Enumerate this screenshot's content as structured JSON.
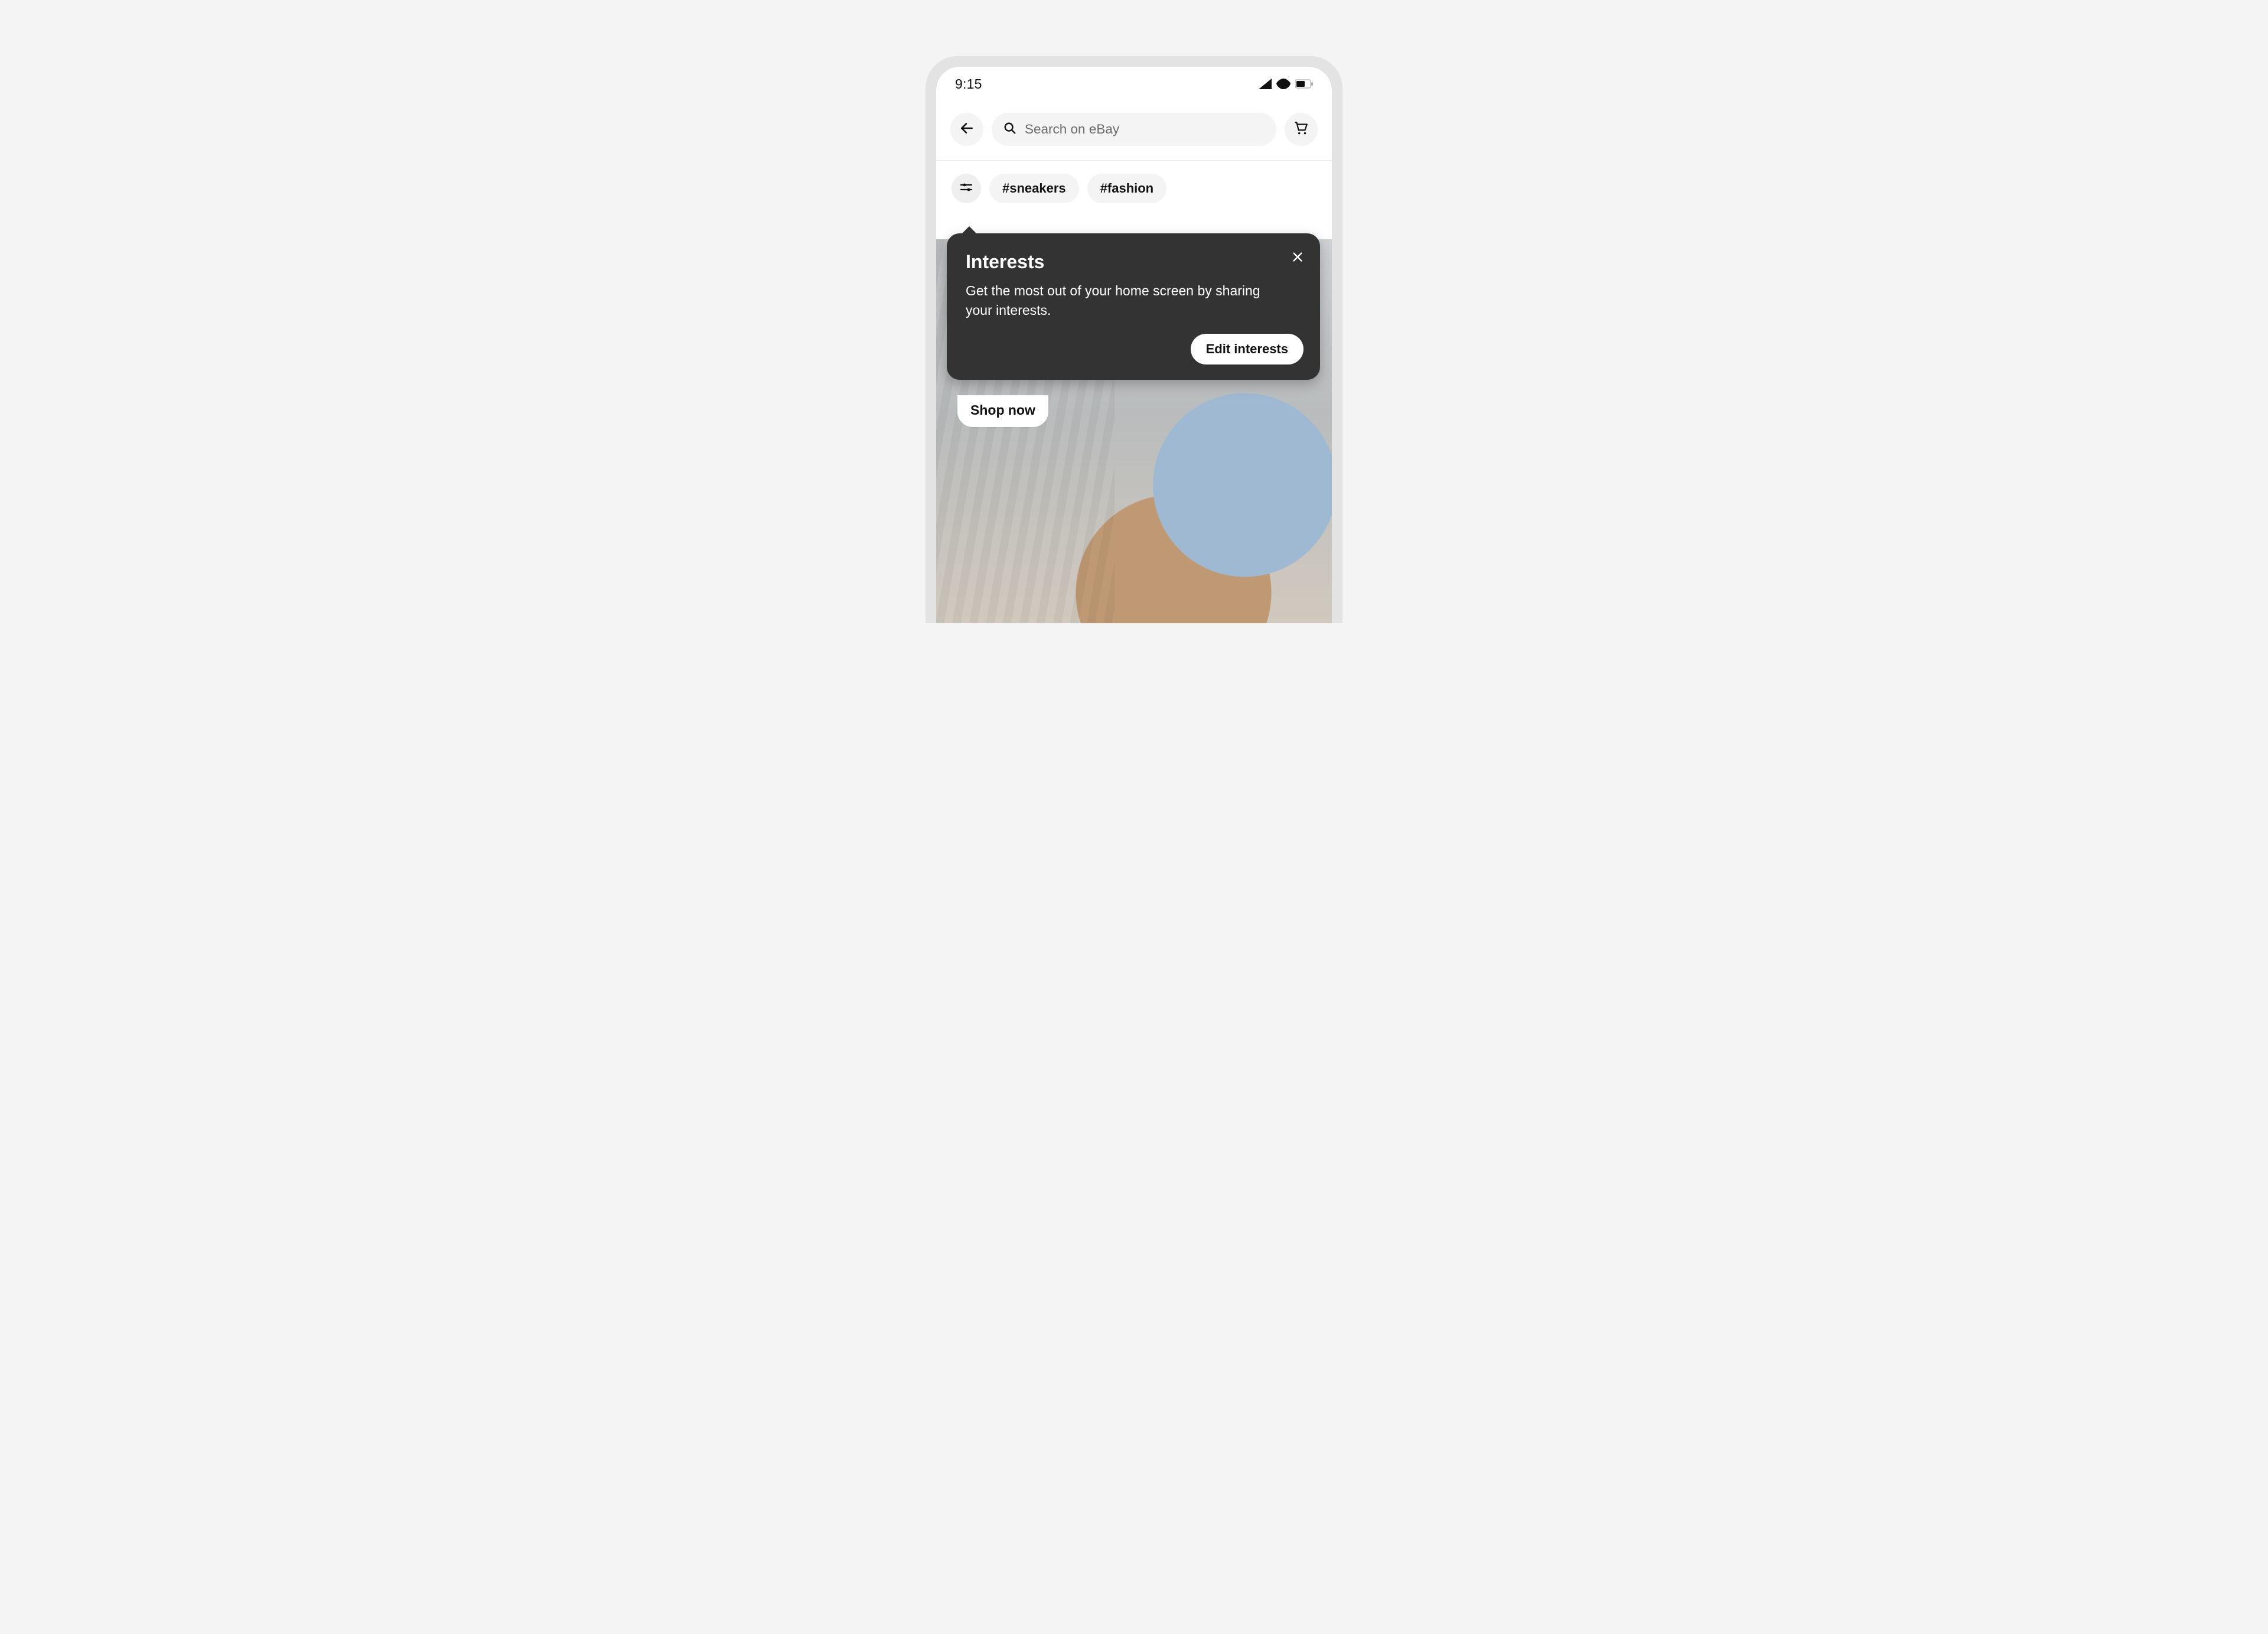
{
  "status": {
    "time": "9:15"
  },
  "topbar": {
    "search_placeholder": "Search on eBay"
  },
  "chips": [
    "#sneakers",
    "#fashion"
  ],
  "hero": {
    "cta": "Shop now"
  },
  "tooltip": {
    "title": "Interests",
    "body": "Get the most out of your home screen by sharing your interests.",
    "cta": "Edit interests"
  },
  "colors": {
    "tooltip_bg": "#333333",
    "pill_bg": "#f4f4f4"
  }
}
